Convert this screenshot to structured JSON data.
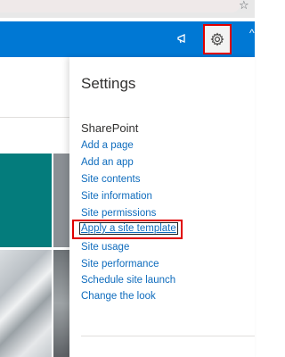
{
  "browser": {
    "star_glyph": "☆"
  },
  "suite_bar": {
    "color": "#0078d4"
  },
  "settings": {
    "title": "Settings",
    "section_title": "SharePoint",
    "links": [
      "Add a page",
      "Add an app",
      "Site contents",
      "Site information",
      "Site permissions",
      "Apply a site template",
      "Site usage",
      "Site performance",
      "Schedule site launch",
      "Change the look"
    ]
  },
  "colors": {
    "link": "#0f6cbd",
    "highlight": "#e00000",
    "tile_teal": "#047c7c"
  }
}
